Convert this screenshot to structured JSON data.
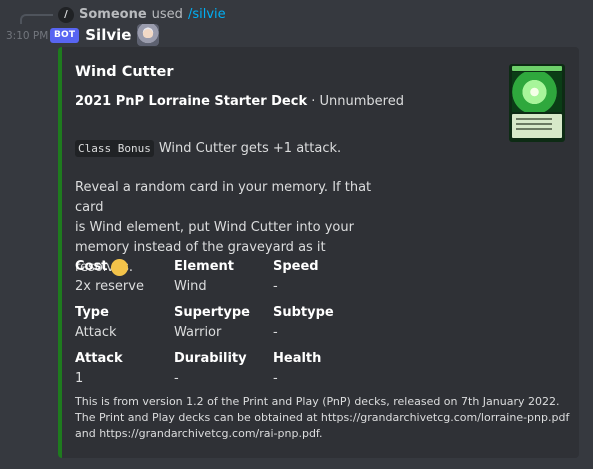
{
  "reply": {
    "user": "Someone",
    "used_text": "used",
    "command": "/silvie"
  },
  "message": {
    "timestamp": "3:10 PM",
    "badge": "BOT",
    "author": "Silvie"
  },
  "embed": {
    "accent_color": "#1e7b1e",
    "title": "Wind Cutter",
    "set_name": "2021 PnP Lorraine Starter Deck",
    "set_suffix": " · Unnumbered",
    "class_bonus_tag": "Class Bonus",
    "class_bonus_text": "Wind Cutter gets +1 attack.",
    "effect_text": "Reveal a random card in your memory. If that card\nis Wind element, put Wind Cutter into your\nmemory instead of the graveyard as it resolves.",
    "fields": [
      {
        "name": "Cost",
        "value": "2x reserve",
        "icon": "reserve-coin-icon"
      },
      {
        "name": "Element",
        "value": "Wind"
      },
      {
        "name": "Speed",
        "value": "-"
      },
      {
        "name": "Type",
        "value": "Attack"
      },
      {
        "name": "Supertype",
        "value": "Warrior"
      },
      {
        "name": "Subtype",
        "value": "-"
      },
      {
        "name": "Attack",
        "value": "1"
      },
      {
        "name": "Durability",
        "value": "-"
      },
      {
        "name": "Health",
        "value": "-"
      }
    ],
    "footer_line1": "This is from version 1.2 of the Print and Play (PnP) decks, released on 7th January 2022.",
    "footer_line2": "The Print and Play decks can be obtained at https://grandarchivetcg.com/lorraine-pnp.pdf and https://grandarchivetcg.com/rai-pnp.pdf.",
    "thumbnail_icon": "card-art-thumbnail"
  }
}
